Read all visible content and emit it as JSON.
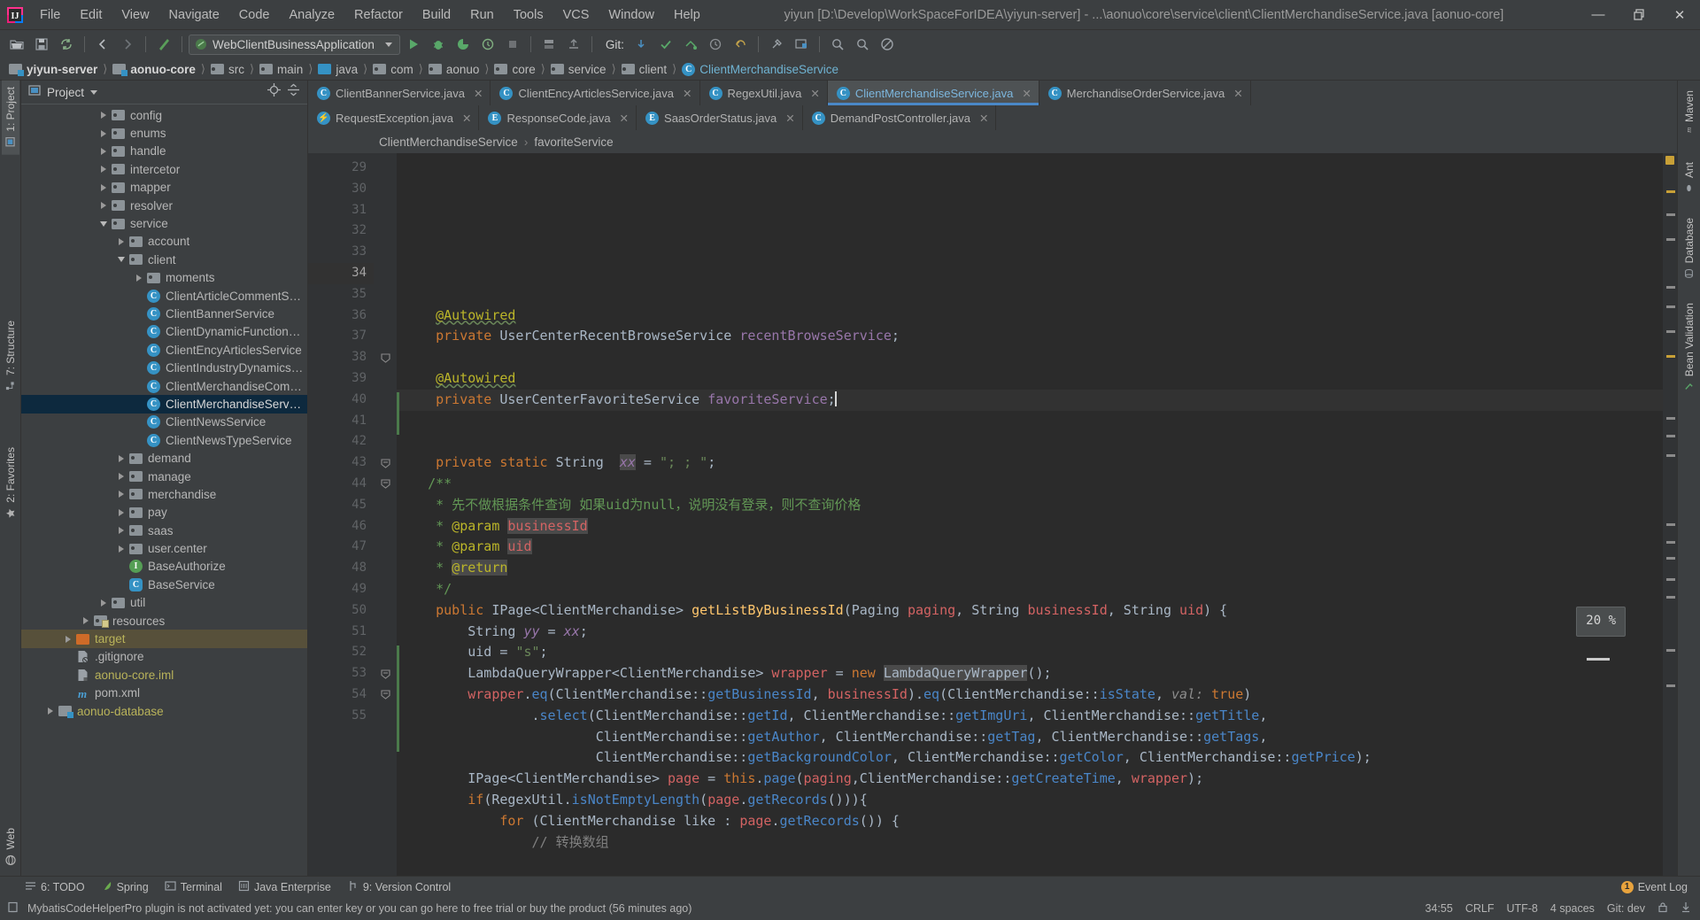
{
  "window": {
    "title": "yiyun [D:\\Develop\\WorkSpaceForIDEA\\yiyun-server] - ...\\aonuo\\core\\service\\client\\ClientMerchandiseService.java [aonuo-core]",
    "minimize": "—",
    "restore": "❐",
    "close": "✕"
  },
  "menu": [
    "File",
    "Edit",
    "View",
    "Navigate",
    "Code",
    "Analyze",
    "Refactor",
    "Build",
    "Run",
    "Tools",
    "VCS",
    "Window",
    "Help"
  ],
  "toolbar": {
    "run_config": "WebClientBusinessApplication",
    "git_label": "Git:",
    "icons": [
      "open-folder-icon",
      "save-all-icon",
      "sync-icon",
      "back-icon",
      "forward-icon",
      "build-icon",
      "run-icon",
      "debug-icon",
      "run-coverage-icon",
      "profiler-icon",
      "stop-icon",
      "update-project-icon",
      "commit-icon",
      "push-icon",
      "checkmark-icon",
      "rollback-icon",
      "history-icon",
      "undo-icon",
      "settings-icon",
      "project-structure-icon",
      "search-everywhere-icon",
      "search-icon",
      "help-icon",
      "no-access-icon"
    ]
  },
  "breadcrumb": [
    {
      "label": "yiyun-server",
      "icon": "module-folder-icon",
      "bold": true
    },
    {
      "label": "aonuo-core",
      "icon": "module-folder-icon",
      "bold": true
    },
    {
      "label": "src",
      "icon": "folder-icon",
      "bold": false
    },
    {
      "label": "main",
      "icon": "folder-icon",
      "bold": false
    },
    {
      "label": "java",
      "icon": "source-folder-icon",
      "bold": false
    },
    {
      "label": "com",
      "icon": "package-icon",
      "bold": false
    },
    {
      "label": "aonuo",
      "icon": "package-icon",
      "bold": false
    },
    {
      "label": "core",
      "icon": "package-icon",
      "bold": false
    },
    {
      "label": "service",
      "icon": "package-icon",
      "bold": false
    },
    {
      "label": "client",
      "icon": "package-icon",
      "bold": false
    },
    {
      "label": "ClientMerchandiseService",
      "icon": "class-icon",
      "bold": false,
      "cls": true
    }
  ],
  "left_strip": {
    "project_tab": "1: Project",
    "structure_tab": "7: Structure",
    "favorites_tab": "2: Favorites",
    "web_tab": "Web"
  },
  "right_strip": {
    "maven_tab": "Maven",
    "ant_tab": "Ant",
    "database_tab": "Database",
    "bean_validation_tab": "Bean Validation"
  },
  "project_panel": {
    "title": "Project",
    "locate_icon": "locate-icon",
    "collapse_icon": "collapse-all-icon",
    "tree": [
      {
        "label": "config",
        "indent": 4,
        "arrow": "right",
        "icon": "package-icon"
      },
      {
        "label": "enums",
        "indent": 4,
        "arrow": "right",
        "icon": "package-icon"
      },
      {
        "label": "handle",
        "indent": 4,
        "arrow": "right",
        "icon": "package-icon"
      },
      {
        "label": "intercetor",
        "indent": 4,
        "arrow": "right",
        "icon": "package-icon"
      },
      {
        "label": "mapper",
        "indent": 4,
        "arrow": "right",
        "icon": "package-icon"
      },
      {
        "label": "resolver",
        "indent": 4,
        "arrow": "right",
        "icon": "package-icon"
      },
      {
        "label": "service",
        "indent": 4,
        "arrow": "down",
        "icon": "package-icon"
      },
      {
        "label": "account",
        "indent": 5,
        "arrow": "right",
        "icon": "package-icon"
      },
      {
        "label": "client",
        "indent": 5,
        "arrow": "down",
        "icon": "package-icon"
      },
      {
        "label": "moments",
        "indent": 6,
        "arrow": "right",
        "icon": "package-icon"
      },
      {
        "label": "ClientArticleCommentService",
        "indent": 6,
        "arrow": "none",
        "icon": "class-icon"
      },
      {
        "label": "ClientBannerService",
        "indent": 6,
        "arrow": "none",
        "icon": "class-icon"
      },
      {
        "label": "ClientDynamicFunctionService",
        "indent": 6,
        "arrow": "none",
        "icon": "class-icon"
      },
      {
        "label": "ClientEncyArticlesService",
        "indent": 6,
        "arrow": "none",
        "icon": "class-icon"
      },
      {
        "label": "ClientIndustryDynamicsService",
        "indent": 6,
        "arrow": "none",
        "icon": "class-icon"
      },
      {
        "label": "ClientMerchandiseCommentService",
        "indent": 6,
        "arrow": "none",
        "icon": "class-icon"
      },
      {
        "label": "ClientMerchandiseService",
        "indent": 6,
        "arrow": "none",
        "icon": "class-icon",
        "selected": true
      },
      {
        "label": "ClientNewsService",
        "indent": 6,
        "arrow": "none",
        "icon": "class-icon"
      },
      {
        "label": "ClientNewsTypeService",
        "indent": 6,
        "arrow": "none",
        "icon": "class-icon"
      },
      {
        "label": "demand",
        "indent": 5,
        "arrow": "right",
        "icon": "package-icon"
      },
      {
        "label": "manage",
        "indent": 5,
        "arrow": "right",
        "icon": "package-icon"
      },
      {
        "label": "merchandise",
        "indent": 5,
        "arrow": "right",
        "icon": "package-icon"
      },
      {
        "label": "pay",
        "indent": 5,
        "arrow": "right",
        "icon": "package-icon"
      },
      {
        "label": "saas",
        "indent": 5,
        "arrow": "right",
        "icon": "package-icon"
      },
      {
        "label": "user.center",
        "indent": 5,
        "arrow": "right",
        "icon": "package-icon"
      },
      {
        "label": "BaseAuthorize",
        "indent": 5,
        "arrow": "none",
        "icon": "interface-icon"
      },
      {
        "label": "BaseService",
        "indent": 5,
        "arrow": "none",
        "icon": "abstract-class-icon"
      },
      {
        "label": "util",
        "indent": 4,
        "arrow": "right",
        "icon": "package-icon"
      },
      {
        "label": "resources",
        "indent": 3,
        "arrow": "right",
        "icon": "resources-folder-icon"
      },
      {
        "label": "target",
        "indent": 2,
        "arrow": "right",
        "icon": "excluded-folder-icon",
        "color": "yellow",
        "context": true
      },
      {
        "label": ".gitignore",
        "indent": 2,
        "arrow": "none",
        "icon": "gitignore-file-icon"
      },
      {
        "label": "aonuo-core.iml",
        "indent": 2,
        "arrow": "none",
        "icon": "iml-file-icon",
        "color": "yellow"
      },
      {
        "label": "pom.xml",
        "indent": 2,
        "arrow": "none",
        "icon": "maven-file-icon"
      },
      {
        "label": "aonuo-database",
        "indent": 1,
        "arrow": "right",
        "icon": "module-folder-icon",
        "color": "yellow"
      }
    ]
  },
  "editor_tabs": {
    "row1": [
      {
        "label": "ClientBannerService.java",
        "icon": "class-icon",
        "active": false
      },
      {
        "label": "ClientEncyArticlesService.java",
        "icon": "class-icon",
        "active": false
      },
      {
        "label": "RegexUtil.java",
        "icon": "class-icon",
        "active": false
      },
      {
        "label": "ClientMerchandiseService.java",
        "icon": "class-icon",
        "active": true
      },
      {
        "label": "MerchandiseOrderService.java",
        "icon": "class-icon",
        "active": false
      }
    ],
    "row2": [
      {
        "label": "RequestException.java",
        "icon": "exception-class-icon",
        "active": false
      },
      {
        "label": "ResponseCode.java",
        "icon": "enum-icon",
        "active": false
      },
      {
        "label": "SaasOrderStatus.java",
        "icon": "enum-icon",
        "active": false
      },
      {
        "label": "DemandPostController.java",
        "icon": "class-icon",
        "active": false
      }
    ],
    "close_glyph": "✕"
  },
  "editor_breadcrumb": {
    "class": "ClientMerchandiseService",
    "separator": "›",
    "member": "favoriteService"
  },
  "editor": {
    "zoom_indicator": "20 %",
    "first_line": 29,
    "lines": [
      {
        "n": 29,
        "html": ""
      },
      {
        "n": 30,
        "html": "    <span class='anno squiggle'>@Autowired</span>"
      },
      {
        "n": 31,
        "html": "    <span class='kw'>private</span> UserCenterRecentBrowseService <span class='fld'>recentBrowseService</span>;",
        "bean": true
      },
      {
        "n": 32,
        "html": ""
      },
      {
        "n": 33,
        "html": "    <span class='anno squiggle'>@Autowired</span>"
      },
      {
        "n": 34,
        "html": "    <span class='kw'>private</span> UserCenterFavoriteService <span class='fld'>favoriteService</span>;<span class='cursor'></span>",
        "bean": true,
        "current": true
      },
      {
        "n": 35,
        "html": ""
      },
      {
        "n": 36,
        "html": ""
      },
      {
        "n": 37,
        "html": "    <span class='kw'>private static</span> String  <span class='stat hl2'>xx</span> = <span class='str'>\"; ; \"</span>;"
      },
      {
        "n": 38,
        "html": "   <span class='doc'>/**</span>",
        "fold": "collapse"
      },
      {
        "n": 39,
        "html": "    <span class='doc'>* 先不做根据条件查询 如果uid为null，说明没有登录，则不查询价格</span>"
      },
      {
        "n": 40,
        "html": "    <span class='doc'>* </span><span class='doctag'>@param</span> <span class='docparam hl2'>businessId</span>"
      },
      {
        "n": 41,
        "html": "    <span class='doc'>* </span><span class='doctag'>@param</span> <span class='docparam hl2'>uid</span>"
      },
      {
        "n": 42,
        "html": "    <span class='doc'>* </span><span class='doctag hl2'>@return</span>"
      },
      {
        "n": 43,
        "html": "    <span class='doc'>*/</span>",
        "fold": "expand"
      },
      {
        "n": 44,
        "html": "    <span class='kw'>public</span> IPage&lt;ClientMerchandise&gt; <span class='mth'>getListByBusinessId</span>(Paging <span class='docparam'>paging</span>, String <span class='docparam'>businessId</span>, String <span class='docparam'>uid</span>) {",
        "fold": "expand"
      },
      {
        "n": 45,
        "html": "        String <span class='stat'>yy</span> = <span class='stat'>xx</span>;"
      },
      {
        "n": 46,
        "html": "        uid = <span class='str'>\"s\"</span>;"
      },
      {
        "n": 47,
        "html": "        LambdaQueryWrapper&lt;ClientMerchandise&gt; <span class='docparam'>wrapper</span> = <span class='kw'>new</span> <span class='hl2'>LambdaQueryWrapper</span>();"
      },
      {
        "n": 48,
        "html": "        <span class='docparam'>wrapper</span>.<span class='mref'>eq</span>(ClientMerchandise::<span class='mref'>getBusinessId</span>, <span class='docparam'>businessId</span>).<span class='mref'>eq</span>(ClientMerchandise::<span class='mref'>isState</span>, <span class='hintp'>val:</span> <span class='kw'>true</span>)"
      },
      {
        "n": 49,
        "html": "                .<span class='mref'>select</span>(ClientMerchandise::<span class='mref'>getId</span>, ClientMerchandise::<span class='mref'>getImgUri</span>, ClientMerchandise::<span class='mref'>getTitle</span>,"
      },
      {
        "n": 50,
        "html": "                        ClientMerchandise::<span class='mref'>getAuthor</span>, ClientMerchandise::<span class='mref'>getTag</span>, ClientMerchandise::<span class='mref'>getTags</span>,"
      },
      {
        "n": 51,
        "html": "                        ClientMerchandise::<span class='mref'>getBackgroundColor</span>, ClientMerchandise::<span class='mref'>getColor</span>, ClientMerchandise::<span class='mref'>getPrice</span>);"
      },
      {
        "n": 52,
        "html": "        IPage&lt;ClientMerchandise&gt; <span class='docparam'>page</span> = <span class='kw'>this</span>.<span class='mref'>page</span>(<span class='docparam'>paging</span>,ClientMerchandise::<span class='mref'>getCreateTime</span>, <span class='docparam'>wrapper</span>);"
      },
      {
        "n": 53,
        "html": "        <span class='kw'>if</span>(RegexUtil.<span class='mref'>isNotEmptyLength</span>(<span class='docparam'>page</span>.<span class='mref'>getRecords</span>())){",
        "fold": "expand"
      },
      {
        "n": 54,
        "html": "            <span class='kw'>for</span> (ClientMerchandise like : <span class='docparam'>page</span>.<span class='mref'>getRecords</span>()) {",
        "fold": "expand"
      },
      {
        "n": 55,
        "html": "                <span class='cmt'>// 转换数组</span>"
      }
    ]
  },
  "bottom_tools": [
    {
      "label": "6: TODO",
      "icon": "todo-icon"
    },
    {
      "label": "Spring",
      "icon": "spring-leaf-icon"
    },
    {
      "label": "Terminal",
      "icon": "terminal-icon"
    },
    {
      "label": "Java Enterprise",
      "icon": "java-enterprise-icon"
    },
    {
      "label": "9: Version Control",
      "icon": "version-control-icon"
    }
  ],
  "event_log": {
    "label": "Event Log",
    "count": "1"
  },
  "status": {
    "message": "MybatisCodeHelperPro plugin is not activated yet: you can enter key or you can go here to free trial or buy the product (56 minutes ago)",
    "caret": "34:55",
    "line_sep": "CRLF",
    "encoding": "UTF-8",
    "indent": "4 spaces",
    "branch": "Git: dev",
    "lock_icon": "lock-icon",
    "inspector_icon": "inspector-icon"
  },
  "colors": {
    "accent": "#4a88c7",
    "panel_bg": "#3c3f41",
    "editor_bg": "#2b2b2b",
    "gutter_bg": "#313335",
    "selection": "#0d293e",
    "keyword": "#cc7832",
    "string": "#6a8759",
    "field": "#9876aa",
    "method": "#ffc66d",
    "comment": "#808080",
    "javadoc": "#629755",
    "annotation": "#bbb529"
  }
}
